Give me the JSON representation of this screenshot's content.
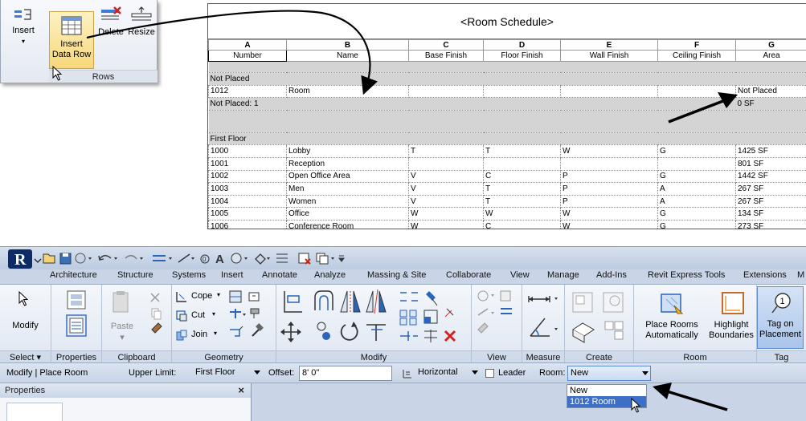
{
  "rows_panel": {
    "insert_label": "Insert",
    "insert_data_row_label_1": "Insert",
    "insert_data_row_label_2": "Data Row",
    "delete_label": "Delete",
    "resize_label": "Resize",
    "panel_title": "Rows"
  },
  "schedule": {
    "title": "<Room Schedule>",
    "column_letters": [
      "A",
      "B",
      "C",
      "D",
      "E",
      "F",
      "G"
    ],
    "column_fields": [
      "Number",
      "Name",
      "Base Finish",
      "Floor Finish",
      "Wall Finish",
      "Ceiling Finish",
      "Area"
    ],
    "groups": [
      {
        "header": "Not Placed",
        "rows": [
          [
            "1012",
            "Room",
            "",
            "",
            "",
            "",
            "Not Placed"
          ]
        ],
        "footer": "Not Placed: 1",
        "footer_area": "0 SF"
      },
      {
        "header": "First Floor",
        "rows": [
          [
            "1000",
            "Lobby",
            "T",
            "T",
            "W",
            "G",
            "1425 SF"
          ],
          [
            "1001",
            "Reception",
            "",
            "",
            "",
            "",
            "801 SF"
          ],
          [
            "1002",
            "Open Office Area",
            "V",
            "C",
            "P",
            "G",
            "1442 SF"
          ],
          [
            "1003",
            "Men",
            "V",
            "T",
            "P",
            "A",
            "267 SF"
          ],
          [
            "1004",
            "Women",
            "V",
            "T",
            "P",
            "A",
            "267 SF"
          ],
          [
            "1005",
            "Office",
            "W",
            "W",
            "W",
            "G",
            "134 SF"
          ],
          [
            "1006",
            "Conference Room",
            "W",
            "C",
            "W",
            "G",
            "273 SF"
          ]
        ]
      }
    ]
  },
  "app": {
    "tabs": [
      "Architecture",
      "Structure",
      "Systems",
      "Insert",
      "Annotate",
      "Analyze",
      "Massing & Site",
      "Collaborate",
      "View",
      "Manage",
      "Add-Ins",
      "Revit Express Tools",
      "Extensions",
      "M"
    ],
    "ribbon": {
      "modify_label": "Modify",
      "paste_label": "Paste",
      "cope_label": "Cope",
      "cut_label": "Cut",
      "join_label": "Join",
      "place_rooms_label_1": "Place Rooms",
      "place_rooms_label_2": "Automatically",
      "highlight_label_1": "Highlight",
      "highlight_label_2": "Boundaries",
      "tag_on_label_1": "Tag on",
      "tag_on_label_2": "Placement",
      "tag_number": "1",
      "panels": [
        "Select",
        "Properties",
        "Clipboard",
        "Geometry",
        "Modify",
        "View",
        "Measure",
        "Create",
        "Room",
        "Tag"
      ]
    },
    "options_bar": {
      "context_label": "Modify | Place Room",
      "upper_limit_label": "Upper Limit:",
      "upper_limit_value": "First Floor",
      "offset_label": "Offset:",
      "offset_value": "8'  0\"",
      "orientation_value": "Horizontal",
      "leader_label": "Leader",
      "room_label": "Room:",
      "room_value": "New",
      "room_options": [
        "New",
        "1012  Room"
      ]
    },
    "properties_title": "Properties",
    "properties_close": "×"
  }
}
